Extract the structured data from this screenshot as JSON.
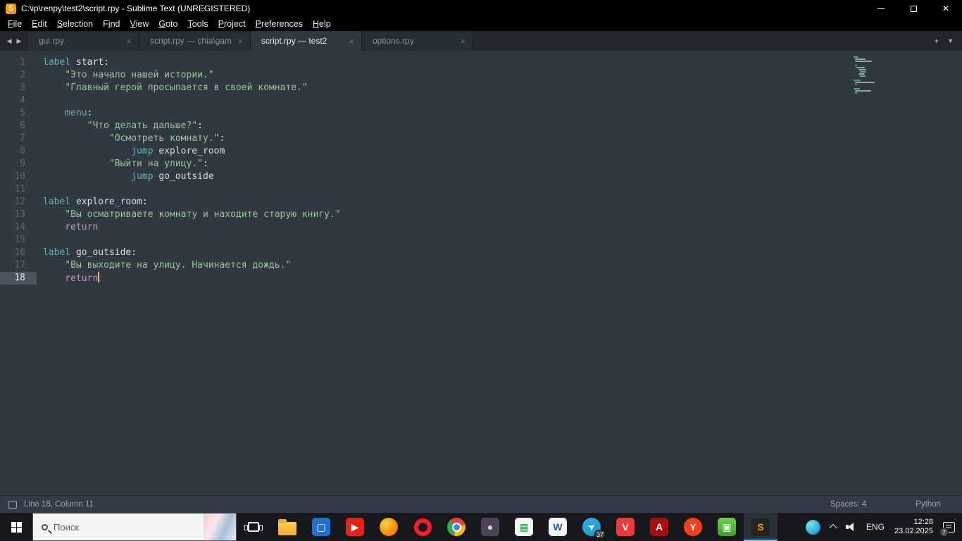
{
  "window": {
    "title": "C:\\ip\\renpy\\test2\\script.rpy - Sublime Text (UNREGISTERED)",
    "logo_glyph": "S",
    "close_glyph": "✕"
  },
  "menu": {
    "items": [
      {
        "label": "File",
        "mnemonic_index": 0
      },
      {
        "label": "Edit",
        "mnemonic_index": 0
      },
      {
        "label": "Selection",
        "mnemonic_index": 0
      },
      {
        "label": "Find",
        "mnemonic_index": 1
      },
      {
        "label": "View",
        "mnemonic_index": 0
      },
      {
        "label": "Goto",
        "mnemonic_index": 0
      },
      {
        "label": "Tools",
        "mnemonic_index": 0
      },
      {
        "label": "Project",
        "mnemonic_index": 0
      },
      {
        "label": "Preferences",
        "mnemonic_index": 0
      },
      {
        "label": "Help",
        "mnemonic_index": 0
      }
    ]
  },
  "tabbar": {
    "left_arrow": "◀",
    "right_arrow": "▶",
    "new_tab_glyph": "+",
    "overflow_glyph": "▼",
    "close_glyph": "×"
  },
  "tabs": [
    {
      "label": "gui.rpy",
      "active": false
    },
    {
      "label": "script.rpy — chia\\game",
      "active": false
    },
    {
      "label": "script.rpy — test2",
      "active": true
    },
    {
      "label": "options.rpy",
      "active": false
    }
  ],
  "editor": {
    "active_line": 18,
    "cursor_line": 18,
    "lines": [
      {
        "num": 1,
        "tokens": [
          {
            "c": "kw",
            "t": "label"
          },
          {
            "c": "fg",
            "t": " start:"
          }
        ]
      },
      {
        "num": 2,
        "tokens": [
          {
            "c": "str",
            "t": "    \"Это начало нашей истории.\""
          }
        ]
      },
      {
        "num": 3,
        "tokens": [
          {
            "c": "str",
            "t": "    \"Главный герой просыпается в своей комнате.\""
          }
        ]
      },
      {
        "num": 4,
        "tokens": []
      },
      {
        "num": 5,
        "tokens": [
          {
            "c": "kw",
            "t": "    menu"
          },
          {
            "c": "fg",
            "t": ":"
          }
        ]
      },
      {
        "num": 6,
        "tokens": [
          {
            "c": "str",
            "t": "        \"Что делать дальше?\""
          },
          {
            "c": "fg",
            "t": ":"
          }
        ]
      },
      {
        "num": 7,
        "tokens": [
          {
            "c": "str",
            "t": "            \"Осмотреть комнату.\""
          },
          {
            "c": "fg",
            "t": ":"
          }
        ]
      },
      {
        "num": 8,
        "tokens": [
          {
            "c": "kw",
            "t": "                jump"
          },
          {
            "c": "fg",
            "t": " explore_room"
          }
        ]
      },
      {
        "num": 9,
        "tokens": [
          {
            "c": "str",
            "t": "            \"Выйти на улицу.\""
          },
          {
            "c": "fg",
            "t": ":"
          }
        ]
      },
      {
        "num": 10,
        "tokens": [
          {
            "c": "kw",
            "t": "                jump"
          },
          {
            "c": "fg",
            "t": " go_outside"
          }
        ]
      },
      {
        "num": 11,
        "tokens": []
      },
      {
        "num": 12,
        "tokens": [
          {
            "c": "kw",
            "t": "label"
          },
          {
            "c": "fg",
            "t": " explore_room:"
          }
        ]
      },
      {
        "num": 13,
        "tokens": [
          {
            "c": "str",
            "t": "    \"Вы осматриваете комнату и находите старую книгу.\""
          }
        ]
      },
      {
        "num": 14,
        "tokens": [
          {
            "c": "flow",
            "t": "    return"
          }
        ]
      },
      {
        "num": 15,
        "tokens": []
      },
      {
        "num": 16,
        "tokens": [
          {
            "c": "kw",
            "t": "label"
          },
          {
            "c": "fg",
            "t": " go_outside:"
          }
        ]
      },
      {
        "num": 17,
        "tokens": [
          {
            "c": "str",
            "t": "    \"Вы выходите на улицу. Начинается дождь.\""
          }
        ]
      },
      {
        "num": 18,
        "tokens": [
          {
            "c": "flow",
            "t": "    return"
          }
        ]
      }
    ],
    "token_colors": {
      "kw": "#5fb4b4",
      "str": "#99c794",
      "flow": "#c695c6",
      "fg": "#d8dee9"
    }
  },
  "status": {
    "position": "Line 18, Column 11",
    "spaces": "Spaces: 4",
    "syntax": "Python"
  },
  "taskbar": {
    "search_placeholder": "Поиск",
    "apps": [
      {
        "name": "file-explorer-icon",
        "type": "folder"
      },
      {
        "name": "photos-app-icon",
        "type": "tile",
        "bg": "#1f6fd4",
        "glyph": "▢",
        "glyph_color": "#ffffff"
      },
      {
        "name": "youtube-icon",
        "type": "tile",
        "bg": "#e62117",
        "glyph": "▶",
        "glyph_color": "#ffffff"
      },
      {
        "name": "firefox-icon",
        "type": "circle",
        "bg": "radial-gradient(circle at 35% 35%, #ffd54f, #ff8f00 55%, #e65100)"
      },
      {
        "name": "opera-icon",
        "type": "ring",
        "border": "#ff1b2d"
      },
      {
        "name": "chrome-icon",
        "type": "chrome"
      },
      {
        "name": "gimp-icon",
        "type": "tile",
        "bg": "#4a4456",
        "glyph": "●",
        "glyph_color": "#d9d4e3"
      },
      {
        "name": "spreadsheet-app-icon",
        "type": "tile",
        "bg": "#f4f6f4",
        "glyph": "▦",
        "glyph_color": "#2e9e49"
      },
      {
        "name": "word-app-icon",
        "type": "tile",
        "bg": "#f4f6fa",
        "glyph": "W",
        "glyph_color": "#2b579a"
      },
      {
        "name": "telegram-icon",
        "type": "circle",
        "bg": "linear-gradient(135deg,#37aee2,#1e96c8)",
        "glyph": "➤",
        "glyph_color": "#ffffff",
        "glyph_rotate": -35,
        "badge": "37"
      },
      {
        "name": "vivaldi-icon",
        "type": "tile",
        "bg": "#ef3939",
        "glyph": "V",
        "glyph_color": "#ffffff"
      },
      {
        "name": "acrobat-icon",
        "type": "tile",
        "bg": "#a50f0f",
        "glyph": "A",
        "glyph_color": "#ffffff"
      },
      {
        "name": "yandex-browser-icon",
        "type": "circle",
        "bg": "#fc3f1d",
        "glyph": "Y",
        "glyph_color": "#ffffff"
      },
      {
        "name": "green-app-icon",
        "type": "tile",
        "bg": "linear-gradient(#6ad04b,#3f9e2f)",
        "glyph": "▣",
        "glyph_color": "#eafbe6"
      },
      {
        "name": "sublime-text-icon",
        "type": "tile",
        "bg": "#23241f",
        "glyph": "S",
        "glyph_color": "#ff9800",
        "active": true
      }
    ],
    "tray": {
      "lang": "ENG",
      "time": "12:28",
      "date": "23.02.2025",
      "notification_count": "7"
    }
  }
}
